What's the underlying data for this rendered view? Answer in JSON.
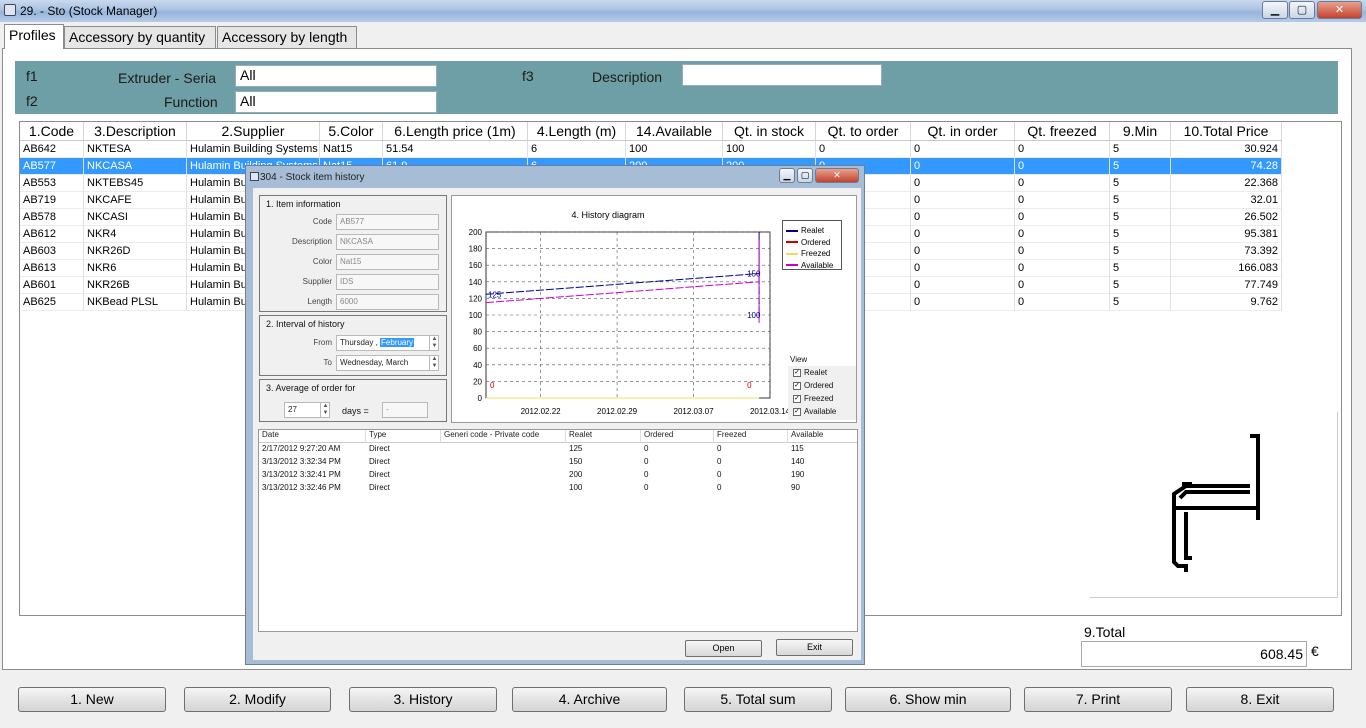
{
  "window": {
    "title": "29. - Sto (Stock Manager)",
    "controls": {
      "minimize": "▁",
      "maximize": "▢",
      "close": "✕"
    },
    "icon": "app-icon"
  },
  "tabs": [
    "Profiles",
    "Accessory by quantity",
    "Accessory by length"
  ],
  "filter": {
    "f1": {
      "key": "f1",
      "label": "Extruder - Seria",
      "value": "All"
    },
    "f2": {
      "key": "f2",
      "label": "Function",
      "value": "All"
    },
    "f3": {
      "key": "f3",
      "label": "Description",
      "value": ""
    }
  },
  "grid": {
    "columns": [
      "1.Code",
      "3.Description",
      "2.Supplier",
      "5.Color",
      "6.Length price (1m)",
      "4.Length (m)",
      "14.Available",
      "Qt. in stock",
      "Qt. to order",
      "Qt. in order",
      "Qt. freezed",
      "9.Min",
      "10.Total Price"
    ],
    "selected_row": 1,
    "rows": [
      [
        "AB642",
        "NKTESA",
        "Hulamin Building Systems",
        "Nat15",
        "51.54",
        "6",
        "100",
        "100",
        "0",
        "0",
        "0",
        "5",
        "30.924"
      ],
      [
        "AB577",
        "NKCASA",
        "Hulamin Building Systems",
        "Nat15",
        "61.9",
        "6",
        "200",
        "200",
        "0",
        "0",
        "0",
        "5",
        "74.28"
      ],
      [
        "AB553",
        "NKTEBS45",
        "Hulamin Bui",
        "",
        "",
        "",
        "",
        "",
        "",
        "0",
        "0",
        "5",
        "22.368"
      ],
      [
        "AB719",
        "NKCAFE",
        "Hulamin Bui",
        "",
        "",
        "",
        "",
        "",
        "",
        "0",
        "0",
        "5",
        "32.01"
      ],
      [
        "AB578",
        "NKCASI",
        "Hulamin Bui",
        "",
        "",
        "",
        "",
        "",
        "",
        "0",
        "0",
        "5",
        "26.502"
      ],
      [
        "AB612",
        "NKR4",
        "Hulamin Bui",
        "",
        "",
        "",
        "",
        "",
        "",
        "0",
        "0",
        "5",
        "95.381"
      ],
      [
        "AB603",
        "NKR26D",
        "Hulamin Bui",
        "",
        "",
        "",
        "",
        "",
        "",
        "0",
        "0",
        "5",
        "73.392"
      ],
      [
        "AB613",
        "NKR6",
        "Hulamin Bui",
        "",
        "",
        "",
        "",
        "",
        "",
        "0",
        "0",
        "5",
        "166.083"
      ],
      [
        "AB601",
        "NKR26B",
        "Hulamin Bui",
        "",
        "",
        "",
        "",
        "",
        "",
        "0",
        "0",
        "5",
        "77.749"
      ],
      [
        "AB625",
        "NKBead PLSL",
        "Hulamin Bui",
        "",
        "",
        "",
        "",
        "",
        "",
        "0",
        "0",
        "5",
        "9.762"
      ]
    ]
  },
  "total": {
    "label": "9.Total",
    "value": "608.45",
    "currency": "€"
  },
  "buttons": [
    "1. New",
    "2. Modify",
    "3. History",
    "4. Archive",
    "5. Total sum",
    "6. Show min",
    "7. Print",
    "8. Exit"
  ],
  "dialog": {
    "title": "304 - Stock item history",
    "item_info": {
      "title": "1. Item information",
      "fields": [
        {
          "label": "Code",
          "value": "AB577"
        },
        {
          "label": "Description",
          "value": "NKCASA"
        },
        {
          "label": "Color",
          "value": "Nat15"
        },
        {
          "label": "Supplier",
          "value": "IDS"
        },
        {
          "label": "Length",
          "value": "6000"
        }
      ]
    },
    "interval": {
      "title": "2. Interval of history",
      "from_label": "From",
      "from_day": "Thursday ,",
      "from_month": "February",
      "to_label": "To",
      "to_day": "Wednesday,",
      "to_month": "March"
    },
    "average": {
      "title": "3. Average of order for",
      "days": "27",
      "days_label": "days =",
      "result": "-"
    },
    "view": {
      "title": "View",
      "items": [
        {
          "label": "Realet",
          "checked": true
        },
        {
          "label": "Ordered",
          "checked": true
        },
        {
          "label": "Freezed",
          "checked": true
        },
        {
          "label": "Available",
          "checked": true
        }
      ]
    },
    "history": {
      "columns": [
        "Date",
        "Type",
        "Generi code - Private code",
        "Realet",
        "Ordered",
        "Freezed",
        "Available"
      ],
      "rows": [
        [
          "2/17/2012 9:27:20 AM",
          "Direct",
          "",
          "125",
          "0",
          "0",
          "115"
        ],
        [
          "3/13/2012 3:32:34 PM",
          "Direct",
          "",
          "150",
          "0",
          "0",
          "140"
        ],
        [
          "3/13/2012 3:32:41 PM",
          "Direct",
          "",
          "200",
          "0",
          "0",
          "190"
        ],
        [
          "3/13/2012 3:32:46 PM",
          "Direct",
          "",
          "100",
          "0",
          "0",
          "90"
        ]
      ]
    },
    "open_label": "Open",
    "exit_label": "Exit",
    "controls": {
      "minimize": "▁",
      "maximize": "▢",
      "close": "✕"
    }
  },
  "chart_data": {
    "type": "line",
    "title": "4. History diagram",
    "ylim": [
      0,
      200
    ],
    "yticks": [
      0,
      20,
      40,
      60,
      80,
      100,
      120,
      140,
      160,
      180,
      200
    ],
    "xlim": [
      "2012-02-17",
      "2012-03-14"
    ],
    "xticks": [
      "2012.02.22",
      "2012.02.29",
      "2012.03.07",
      "2012.03.14"
    ],
    "grid": true,
    "legend_position": "top-right",
    "series": [
      {
        "name": "Realet",
        "color": "#00008b",
        "points": [
          [
            "2012-02-17",
            125
          ],
          [
            "2012-03-13",
            150
          ],
          [
            "2012-03-13",
            200
          ],
          [
            "2012-03-13",
            100
          ]
        ]
      },
      {
        "name": "Ordered",
        "color": "#cc0000",
        "points": [
          [
            "2012-02-17",
            0
          ],
          [
            "2012-03-13",
            0
          ]
        ]
      },
      {
        "name": "Freezed",
        "color": "#e8e060",
        "points": [
          [
            "2012-02-17",
            0
          ],
          [
            "2012-03-13",
            0
          ]
        ]
      },
      {
        "name": "Available",
        "color": "#cc00cc",
        "points": [
          [
            "2012-02-17",
            115
          ],
          [
            "2012-03-13",
            140
          ],
          [
            "2012-03-13",
            190
          ],
          [
            "2012-03-13",
            90
          ]
        ]
      }
    ],
    "annotations": [
      {
        "text": "125",
        "x": "2012-02-17",
        "y": 125,
        "color": "#00008b"
      },
      {
        "text": "0",
        "x": "2012-02-17",
        "y": 0,
        "color": "#cc0000"
      },
      {
        "text": "150",
        "x": "2012-03-13",
        "y": 150,
        "color": "#00008b"
      },
      {
        "text": "100",
        "x": "2012-03-13",
        "y": 100,
        "color": "#00008b"
      },
      {
        "text": "0",
        "x": "2012-03-13",
        "y": 0,
        "color": "#cc0000"
      }
    ]
  }
}
